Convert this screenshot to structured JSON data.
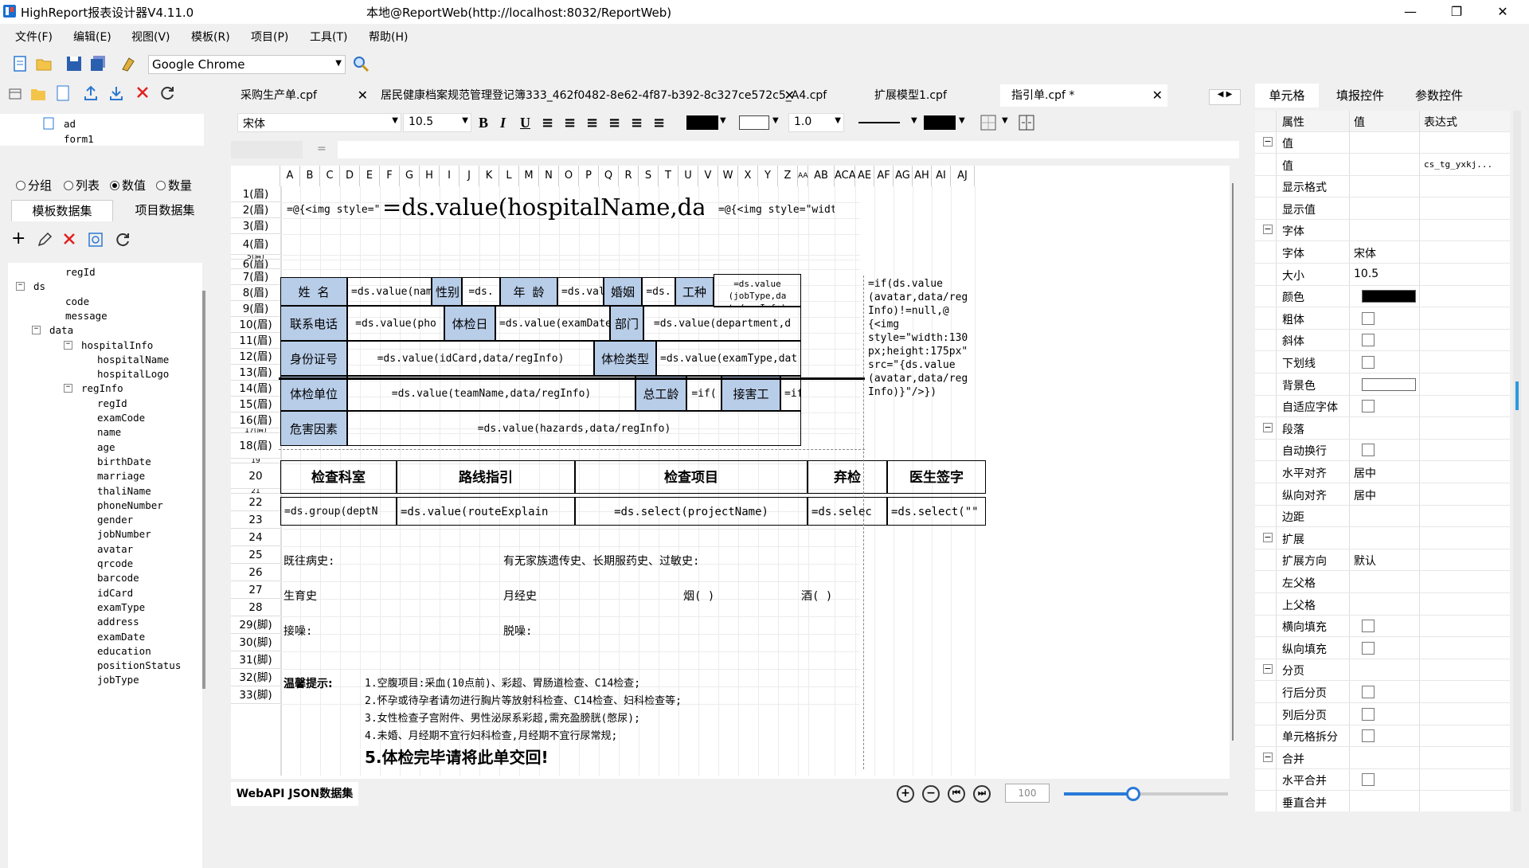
{
  "window": {
    "app_title": "HighReport报表设计器V4.11.0",
    "connection": "本地@ReportWeb(http://localhost:8032/ReportWeb)"
  },
  "menu": [
    "文件(F)",
    "编辑(E)",
    "视图(V)",
    "模板(R)",
    "项目(P)",
    "工具(T)",
    "帮助(H)"
  ],
  "toolbar": {
    "browser": "Google Chrome"
  },
  "left": {
    "tree_top": [
      "ad",
      "form1"
    ],
    "radios": [
      "分组",
      "列表",
      "数值",
      "数量"
    ],
    "radio_selected": "数值",
    "tabs": [
      "模板数据集",
      "项目数据集"
    ],
    "tree": [
      {
        "label": "regId",
        "indent": 2
      },
      {
        "label": "ds",
        "indent": 0
      },
      {
        "label": "code",
        "indent": 2
      },
      {
        "label": "message",
        "indent": 2
      },
      {
        "label": "data",
        "indent": 1
      },
      {
        "label": "hospitalInfo",
        "indent": 3
      },
      {
        "label": "hospitalName",
        "indent": 4
      },
      {
        "label": "hospitalLogo",
        "indent": 4
      },
      {
        "label": "regInfo",
        "indent": 3
      },
      {
        "label": "regId",
        "indent": 4
      },
      {
        "label": "examCode",
        "indent": 4
      },
      {
        "label": "name",
        "indent": 4
      },
      {
        "label": "age",
        "indent": 4
      },
      {
        "label": "birthDate",
        "indent": 4
      },
      {
        "label": "marriage",
        "indent": 4
      },
      {
        "label": "thaliName",
        "indent": 4
      },
      {
        "label": "phoneNumber",
        "indent": 4
      },
      {
        "label": "gender",
        "indent": 4
      },
      {
        "label": "jobNumber",
        "indent": 4
      },
      {
        "label": "avatar",
        "indent": 4
      },
      {
        "label": "qrcode",
        "indent": 4
      },
      {
        "label": "barcode",
        "indent": 4
      },
      {
        "label": "idCard",
        "indent": 4
      },
      {
        "label": "examType",
        "indent": 4
      },
      {
        "label": "address",
        "indent": 4
      },
      {
        "label": "examDate",
        "indent": 4
      },
      {
        "label": "education",
        "indent": 4
      },
      {
        "label": "positionStatus",
        "indent": 4
      },
      {
        "label": "jobType",
        "indent": 4
      }
    ],
    "bottom_tab": "WebAPI JSON数据集"
  },
  "doc_tabs": [
    {
      "label": "采购生产单.cpf",
      "active": false
    },
    {
      "label": "居民健康档案规范管理登记簿333_462f0482-8e62-4f87-b392-8c327ce572c5_A4.cpf",
      "active": false
    },
    {
      "label": "扩展模型1.cpf",
      "active": false
    },
    {
      "label": "指引单.cpf *",
      "active": true
    }
  ],
  "format": {
    "font": "宋体",
    "size": "10.5",
    "line_width": "1.0"
  },
  "formula": {
    "eq": "="
  },
  "columns": [
    "A",
    "B",
    "C",
    "D",
    "E",
    "F",
    "G",
    "H",
    "I",
    "J",
    "K",
    "L",
    "M",
    "N",
    "O",
    "P",
    "Q",
    "R",
    "S",
    "T",
    "U",
    "V",
    "W",
    "X",
    "Y",
    "Z",
    "AA",
    "AB",
    "ACA",
    "AE",
    "AF",
    "AG",
    "AH",
    "AI",
    "AJ"
  ],
  "rows": {
    "r1": "1(眉)",
    "r2": "2(眉)",
    "r3": "3(眉)",
    "r4": "4(眉)",
    "r5": "5(眉)",
    "r6": "6(眉)",
    "r7": "7(眉)",
    "r8": "8(眉)",
    "r9": "9(眉)",
    "r10": "10(眉)",
    "r11": "11(眉)",
    "r12": "12(眉)",
    "r13": "13(眉)",
    "r14": "14(眉)",
    "r15": "15(眉)",
    "r16": "16(眉)",
    "r17": "17(眉)",
    "r18": "18(眉)",
    "r19": "19",
    "r20": "20",
    "r21": "21",
    "r22": "22",
    "r23": "23",
    "r24": "24",
    "r25": "25",
    "r26": "26",
    "r27": "27",
    "r28": "28",
    "r29": "29(脚)",
    "r30": "30(脚)",
    "r31": "31(脚)",
    "r32": "32(脚)",
    "r33": "33(脚)"
  },
  "cells": {
    "img_left": "=@{<img style=\"",
    "hospital": "=ds.value(hospitalName,data/",
    "img_right": "=@{<img style=\"width",
    "name_lbl": "姓 名",
    "name_val": "=ds.value(nam",
    "sex_lbl": "性别",
    "sex_val": "=ds.",
    "age_lbl": "年 龄",
    "age_val": "=ds.val",
    "mar_lbl": "婚姻",
    "mar_val": "=ds.",
    "job_lbl": "工种",
    "job_val": "=ds.value\n(jobType,da\nta/regInfo)",
    "phone_lbl": "联系电话",
    "phone_val": "=ds.value(pho",
    "date_lbl": "体检日",
    "date_val": "=ds.value(examDate",
    "dept_lbl": "部门",
    "dept_val": "=ds.value(department,d",
    "id_lbl": "身份证号",
    "id_val": "=ds.value(idCard,data/regInfo)",
    "type_lbl": "体检类型",
    "type_val": "=ds.value(examType,dat",
    "unit_lbl": "体检单位",
    "unit_val": "=ds.value(teamName,data/regInfo)",
    "seni_lbl": "总工龄",
    "seni_val": "=if(",
    "exp_lbl": "接害工",
    "exp_val": "=if(ds.v",
    "haz_lbl": "危害因素",
    "haz_val": "=ds.value(hazards,data/regInfo)",
    "avatar": "=if(ds.value\n(avatar,data/reg\nInfo)!=null,@\n{<img\nstyle=\"width:130\npx;height:175px\"\nsrc=\"{ds.value\n(avatar,data/reg\nInfo)}\"/>})",
    "h_dept": "检查科室",
    "h_route": "路线指引",
    "h_item": "检查项目",
    "h_abandon": "弃检",
    "h_sign": "医生签字",
    "d_dept": "=ds.group(deptN",
    "d_route": "=ds.value(routeExplain",
    "d_item": "=ds.select(projectName)",
    "d_abandon": "=ds.selec",
    "d_sign": "=ds.select(\"\"",
    "past": "既往病史:",
    "family": "有无家族遗传史、长期服药史、过敏史:",
    "birth": "生育史",
    "mens": "月经史",
    "smoke": "烟(       )",
    "drink": "酒(       )",
    "noise": "接噪:",
    "leave": "脱噪:",
    "tips": "温馨提示:",
    "tip1": "1.空腹项目:采血(10点前)、彩超、胃肠道检查、C14检查;",
    "tip2": "2.怀孕或待孕者请勿进行胸片等放射科检查、C14检查、妇科检查等;",
    "tip3": "3.女性检查子宫附件、男性泌尿系彩超,需充盈膀胱(憋尿);",
    "tip4": "4.未婚、月经期不宜行妇科检查,月经期不宜行尿常规;",
    "tip5": "5.体检完毕请将此单交回!"
  },
  "zoom": "100",
  "right": {
    "tabs": [
      "单元格",
      "填报控件",
      "参数控件"
    ],
    "headers": [
      "属性",
      "值",
      "表达式"
    ],
    "props": [
      {
        "type": "group",
        "k": "值"
      },
      {
        "type": "text",
        "k": "值",
        "v": "",
        "e": "cs_tg_yxkj..."
      },
      {
        "type": "text",
        "k": "显示格式",
        "v": ""
      },
      {
        "type": "text",
        "k": "显示值",
        "v": ""
      },
      {
        "type": "group",
        "k": "字体"
      },
      {
        "type": "text",
        "k": "字体",
        "v": "宋体"
      },
      {
        "type": "text",
        "k": "大小",
        "v": "10.5"
      },
      {
        "type": "color",
        "k": "颜色",
        "v": "#000000"
      },
      {
        "type": "check",
        "k": "粗体"
      },
      {
        "type": "check",
        "k": "斜体"
      },
      {
        "type": "check",
        "k": "下划线"
      },
      {
        "type": "color",
        "k": "背景色",
        "v": "#ffffff"
      },
      {
        "type": "check",
        "k": "自适应字体"
      },
      {
        "type": "group",
        "k": "段落"
      },
      {
        "type": "check",
        "k": "自动换行"
      },
      {
        "type": "text",
        "k": "水平对齐",
        "v": "居中"
      },
      {
        "type": "text",
        "k": "纵向对齐",
        "v": "居中"
      },
      {
        "type": "text",
        "k": "边距",
        "v": ""
      },
      {
        "type": "group",
        "k": "扩展"
      },
      {
        "type": "text",
        "k": "扩展方向",
        "v": "默认"
      },
      {
        "type": "text",
        "k": "左父格",
        "v": ""
      },
      {
        "type": "text",
        "k": "上父格",
        "v": ""
      },
      {
        "type": "check",
        "k": "横向填充"
      },
      {
        "type": "check",
        "k": "纵向填充"
      },
      {
        "type": "group",
        "k": "分页"
      },
      {
        "type": "check",
        "k": "行后分页"
      },
      {
        "type": "check",
        "k": "列后分页"
      },
      {
        "type": "check",
        "k": "单元格拆分"
      },
      {
        "type": "group",
        "k": "合并"
      },
      {
        "type": "check",
        "k": "水平合并"
      },
      {
        "type": "text",
        "k": "垂直合并",
        "v": ""
      }
    ]
  }
}
